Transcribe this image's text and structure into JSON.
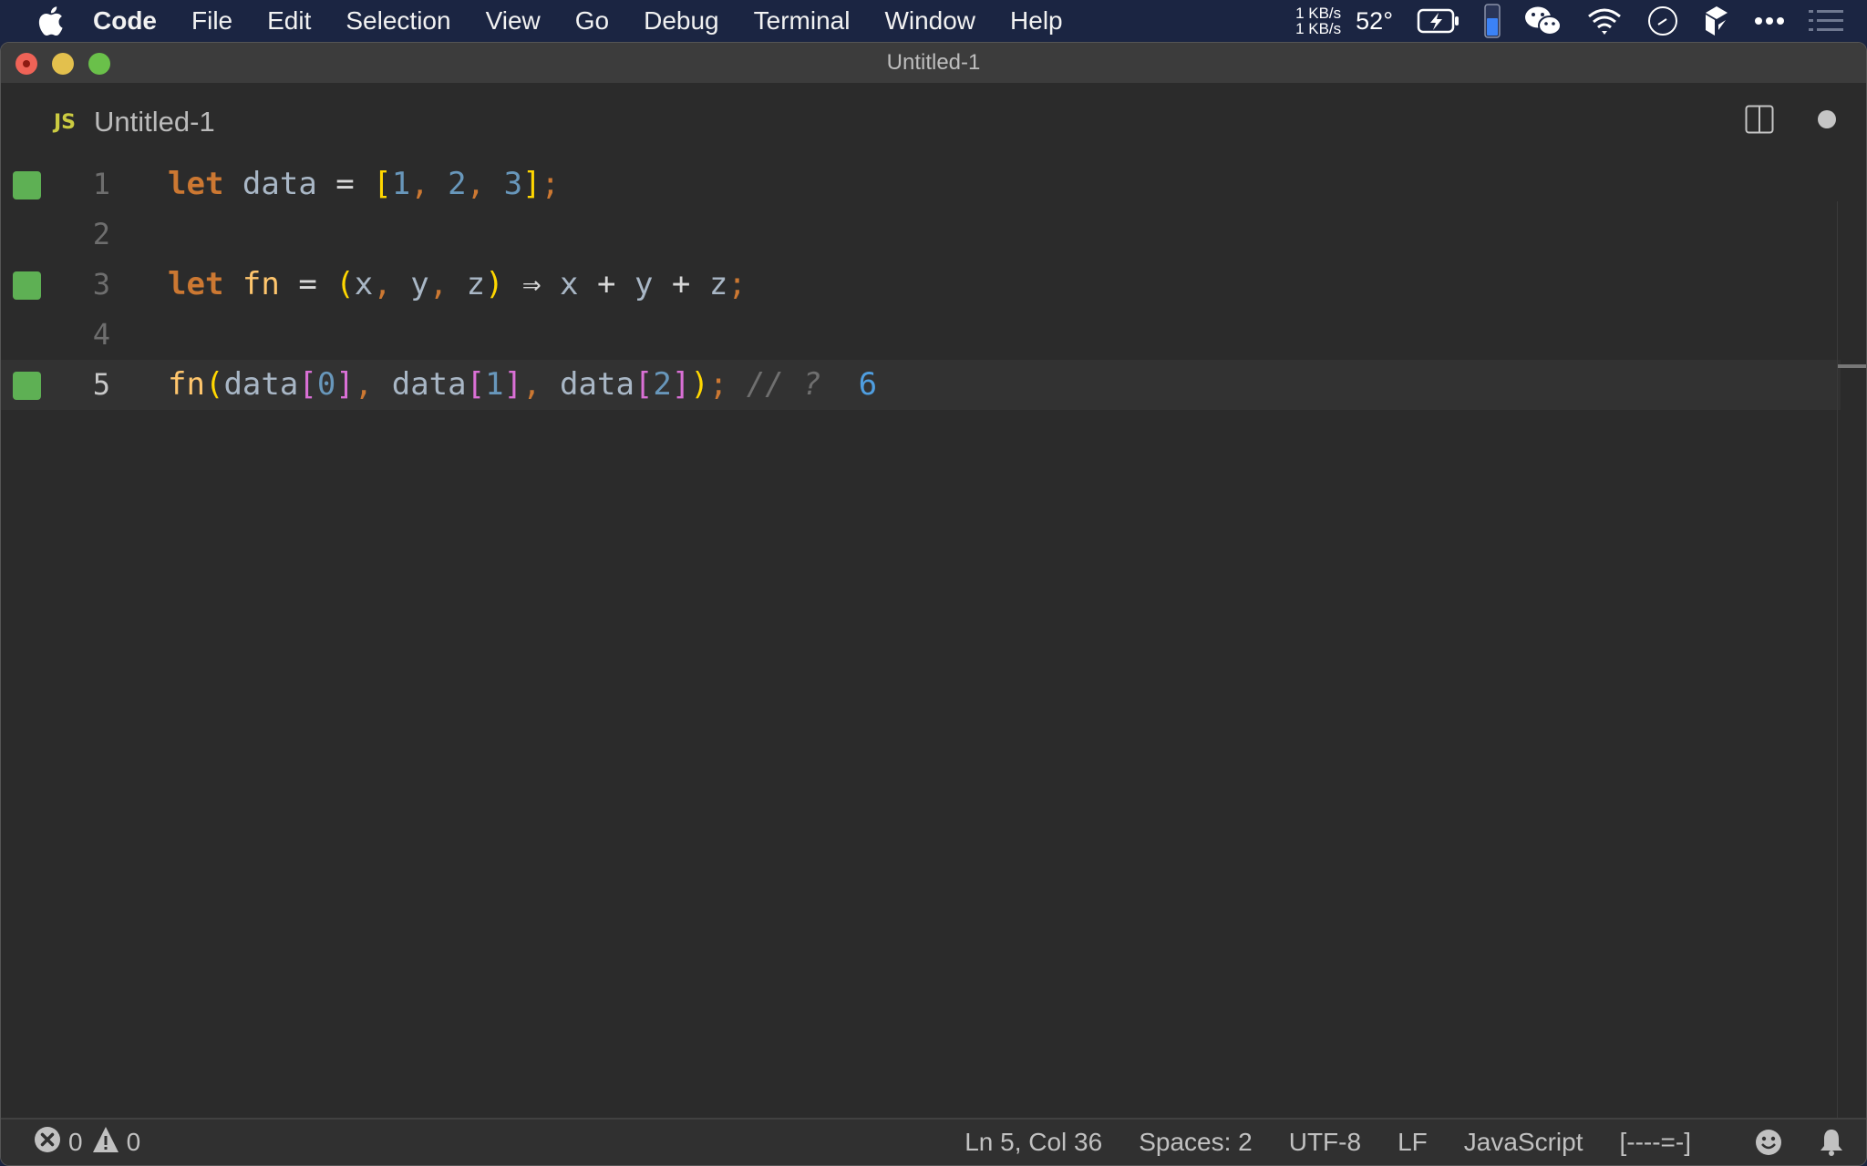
{
  "menubar": {
    "apple_icon": "apple-logo-icon",
    "items": [
      "Code",
      "File",
      "Edit",
      "Selection",
      "View",
      "Go",
      "Debug",
      "Terminal",
      "Window",
      "Help"
    ],
    "network": {
      "up": "1 KB/s",
      "down": "1 KB/s"
    },
    "temperature": "52°",
    "tray_icons": [
      "battery-charging-icon",
      "memory-gauge-icon",
      "wechat-icon",
      "wifi-icon",
      "clock-icon",
      "app-cube-icon",
      "more-icon",
      "notification-list-icon"
    ],
    "accent_colors": {
      "memory_fill": "#3b82f6"
    }
  },
  "window": {
    "title": "Untitled-1",
    "traffic_lights": {
      "close": "#ef6357",
      "minimize": "#e3c04d",
      "maximize": "#6ac04a"
    }
  },
  "tabs": [
    {
      "badge": "JS",
      "label": "Untitled-1",
      "dirty": true
    }
  ],
  "editor_actions": {
    "split_icon": "split-editor-icon",
    "dirty_indicator": "unsaved-dot-icon"
  },
  "editor": {
    "lines": [
      {
        "number": "1",
        "marker": true,
        "tokens": [
          {
            "t": "let",
            "c": "kw"
          },
          {
            "t": " ",
            "c": "var"
          },
          {
            "t": "data",
            "c": "var"
          },
          {
            "t": " = ",
            "c": "op"
          },
          {
            "t": "[",
            "c": "br1"
          },
          {
            "t": "1",
            "c": "num"
          },
          {
            "t": ", ",
            "c": "punc"
          },
          {
            "t": "2",
            "c": "num"
          },
          {
            "t": ", ",
            "c": "punc"
          },
          {
            "t": "3",
            "c": "num"
          },
          {
            "t": "]",
            "c": "br1"
          },
          {
            "t": ";",
            "c": "punc"
          }
        ]
      },
      {
        "number": "2",
        "marker": false,
        "tokens": []
      },
      {
        "number": "3",
        "marker": true,
        "tokens": [
          {
            "t": "let",
            "c": "kw"
          },
          {
            "t": " ",
            "c": "var"
          },
          {
            "t": "fn",
            "c": "fn"
          },
          {
            "t": " = ",
            "c": "op"
          },
          {
            "t": "(",
            "c": "br1"
          },
          {
            "t": "x",
            "c": "var"
          },
          {
            "t": ", ",
            "c": "punc"
          },
          {
            "t": "y",
            "c": "var"
          },
          {
            "t": ", ",
            "c": "punc"
          },
          {
            "t": "z",
            "c": "var"
          },
          {
            "t": ")",
            "c": "br1"
          },
          {
            "t": " ⇒ ",
            "c": "op"
          },
          {
            "t": "x",
            "c": "var"
          },
          {
            "t": " + ",
            "c": "op"
          },
          {
            "t": "y",
            "c": "var"
          },
          {
            "t": " + ",
            "c": "op"
          },
          {
            "t": "z",
            "c": "var"
          },
          {
            "t": ";",
            "c": "punc"
          }
        ]
      },
      {
        "number": "4",
        "marker": false,
        "tokens": []
      },
      {
        "number": "5",
        "marker": true,
        "current": true,
        "tokens": [
          {
            "t": "fn",
            "c": "fn"
          },
          {
            "t": "(",
            "c": "br1"
          },
          {
            "t": "data",
            "c": "var"
          },
          {
            "t": "[",
            "c": "br2"
          },
          {
            "t": "0",
            "c": "num"
          },
          {
            "t": "]",
            "c": "br2"
          },
          {
            "t": ", ",
            "c": "punc"
          },
          {
            "t": "data",
            "c": "var"
          },
          {
            "t": "[",
            "c": "br2"
          },
          {
            "t": "1",
            "c": "num"
          },
          {
            "t": "]",
            "c": "br2"
          },
          {
            "t": ", ",
            "c": "punc"
          },
          {
            "t": "data",
            "c": "var"
          },
          {
            "t": "[",
            "c": "br2"
          },
          {
            "t": "2",
            "c": "num"
          },
          {
            "t": "]",
            "c": "br2"
          },
          {
            "t": ")",
            "c": "br1"
          },
          {
            "t": ";",
            "c": "punc"
          },
          {
            "t": " // ?",
            "c": "cmt"
          },
          {
            "t": "  6",
            "c": "result"
          }
        ]
      }
    ],
    "marker_color": "#5eb054"
  },
  "statusbar": {
    "errors": "0",
    "warnings": "0",
    "cursor": "Ln 5, Col 36",
    "indent": "Spaces: 2",
    "encoding": "UTF-8",
    "eol": "LF",
    "language": "JavaScript",
    "progress": "[----=-]",
    "feedback_icon": "smiley-icon",
    "notifications_icon": "bell-icon"
  }
}
